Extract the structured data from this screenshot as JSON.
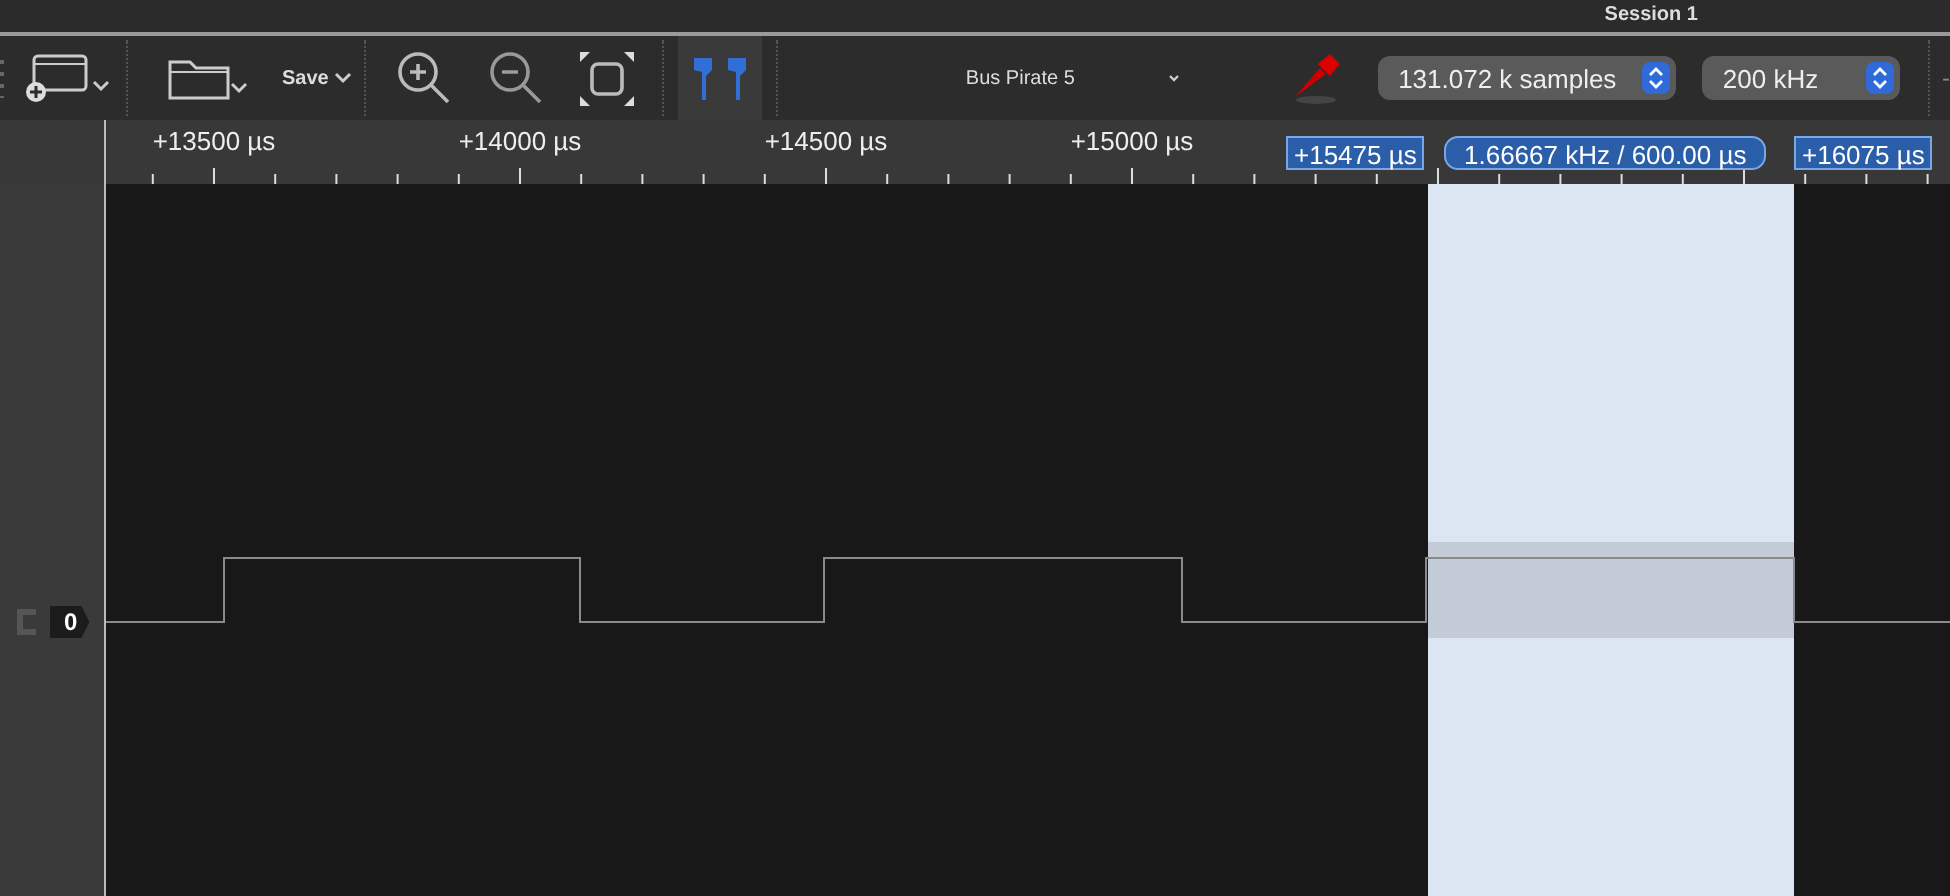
{
  "window": {
    "title": "Session 1"
  },
  "toolbar": {
    "save_label": "Save",
    "cursor_toggle": {
      "selected": true
    },
    "device": "Bus Pirate 5",
    "samples": "131.072 k samples",
    "rate": "200 kHz",
    "more": "-"
  },
  "ruler": {
    "labels": [
      "+13500 µs",
      "+14000 µs",
      "+14500 µs",
      "+15000 µs"
    ]
  },
  "markers": {
    "start": "+15475 µs",
    "measurement": "1.66667 kHz / 600.00 µs",
    "end": "+16075 µs"
  },
  "channels": [
    {
      "label": "0"
    }
  ]
}
